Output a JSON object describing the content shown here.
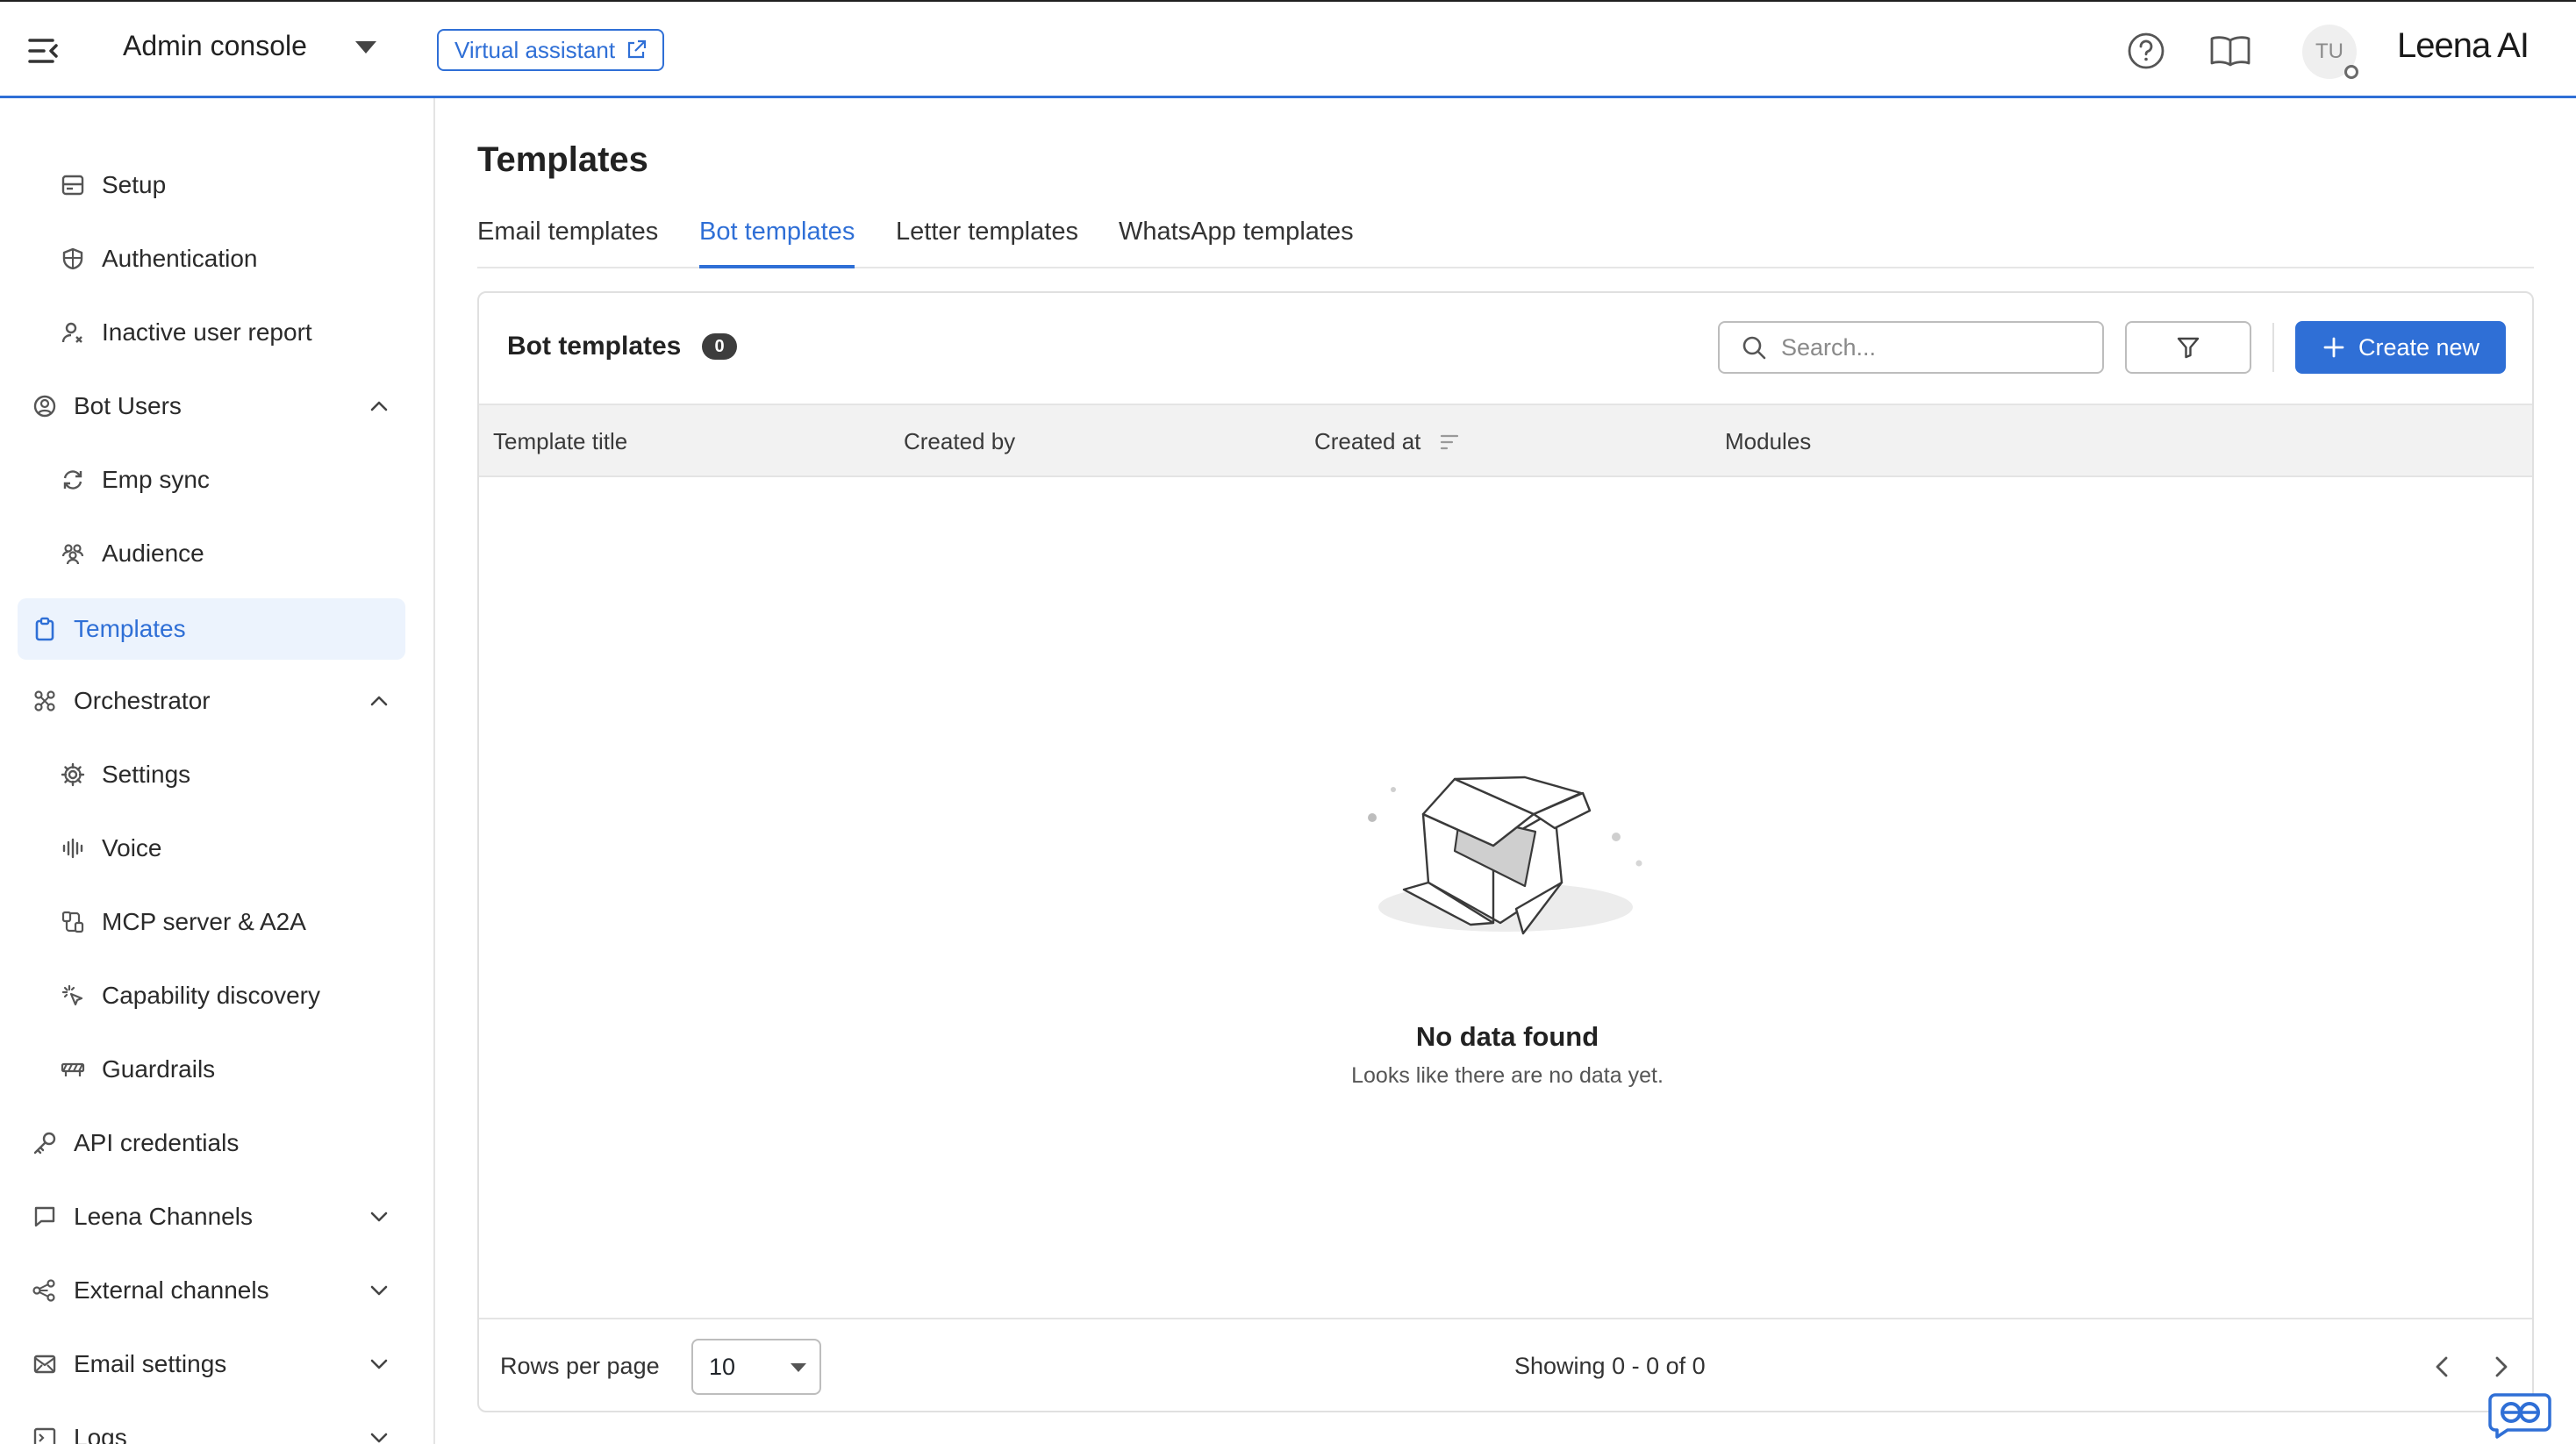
{
  "header": {
    "app_title": "Admin console",
    "virtual_assistant_label": "Virtual assistant",
    "avatar_initials": "TU",
    "brand": "Leena AI"
  },
  "sidebar": {
    "items": [
      {
        "label": "Setup",
        "icon": "setup-icon"
      },
      {
        "label": "Authentication",
        "icon": "shield-icon"
      },
      {
        "label": "Inactive user report",
        "icon": "user-x-icon"
      },
      {
        "label": "Bot Users",
        "icon": "user-circle-icon",
        "expanded": true
      },
      {
        "label": "Emp sync",
        "icon": "sync-icon"
      },
      {
        "label": "Audience",
        "icon": "group-icon"
      },
      {
        "label": "Templates",
        "icon": "clipboard-icon",
        "active": true
      },
      {
        "label": "Orchestrator",
        "icon": "orchestrator-icon",
        "expanded": true
      },
      {
        "label": "Settings",
        "icon": "gear-icon"
      },
      {
        "label": "Voice",
        "icon": "waveform-icon"
      },
      {
        "label": "MCP server & A2A",
        "icon": "mcp-icon"
      },
      {
        "label": "Capability discovery",
        "icon": "sparkle-cursor-icon"
      },
      {
        "label": "Guardrails",
        "icon": "barrier-icon"
      },
      {
        "label": "API credentials",
        "icon": "key-icon"
      },
      {
        "label": "Leena Channels",
        "icon": "chat-icon",
        "expanded": false
      },
      {
        "label": "External channels",
        "icon": "share-nodes-icon",
        "expanded": false
      },
      {
        "label": "Email settings",
        "icon": "mail-icon",
        "expanded": false
      },
      {
        "label": "Logs",
        "icon": "terminal-icon",
        "expanded": false
      }
    ]
  },
  "main": {
    "page_title": "Templates",
    "tabs": [
      {
        "label": "Email templates"
      },
      {
        "label": "Bot templates",
        "active": true
      },
      {
        "label": "Letter templates"
      },
      {
        "label": "WhatsApp templates"
      }
    ],
    "card": {
      "title": "Bot templates",
      "count": "0",
      "search_placeholder": "Search...",
      "create_label": "Create new",
      "columns": [
        "Template title",
        "Created by",
        "Created at",
        "Modules"
      ],
      "empty_title": "No data found",
      "empty_subtitle": "Looks like there are no data yet.",
      "rows_per_page_label": "Rows per page",
      "rows_per_page_value": "10",
      "showing_text": "Showing 0 - 0 of 0"
    }
  },
  "colors": {
    "accent": "#2f6fd6",
    "active_bg": "#ecf3fd"
  }
}
